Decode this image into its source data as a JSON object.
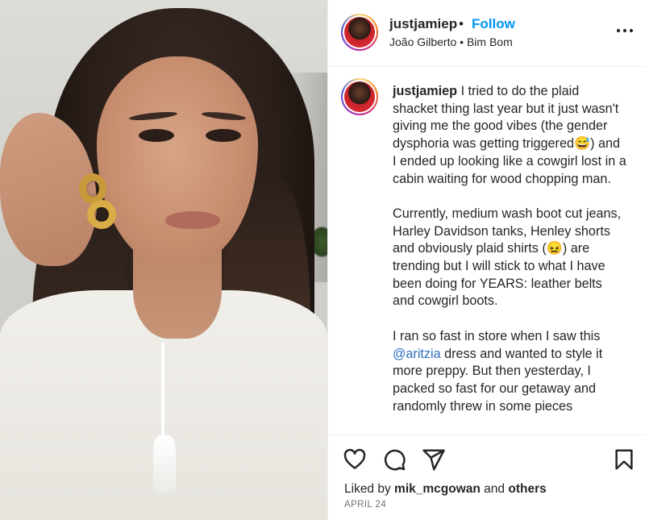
{
  "post": {
    "username": "justjamiep",
    "separator": "•",
    "follow_label": "Follow",
    "audio": "João Gilberto • Bim Bom"
  },
  "caption": {
    "username": "justjamiep",
    "paragraph1": "I tried to do the plaid shacket thing last year but it just wasn't giving me the good vibes (the gender dysphoria was getting triggered😅) and I ended up looking like a cowgirl lost in a cabin waiting for wood chopping man.",
    "paragraph2": "Currently, medium wash boot cut jeans, Harley Davidson tanks, Henley shorts and obviously plaid shirts (😖) are trending but I will stick to what I have been doing for YEARS: leather belts and cowgirl boots.",
    "paragraph3_pre": "I ran so fast in store when I saw this",
    "paragraph3_mention": "@aritzia",
    "paragraph3_post": "dress and wanted to style it more preppy. But then yesterday, I packed so fast for our getaway and randomly threw in some pieces"
  },
  "footer": {
    "liked_prefix": "Liked by",
    "liked_user": "mik_mcgowan",
    "liked_and": "and",
    "liked_others": "others",
    "date": "APRIL 24"
  },
  "icons": {
    "more": "more-icon",
    "like": "heart-icon",
    "comment": "comment-icon",
    "share": "share-icon",
    "save": "bookmark-icon"
  },
  "colors": {
    "follow": "#0095f6",
    "text": "#262626",
    "muted": "#737373"
  }
}
